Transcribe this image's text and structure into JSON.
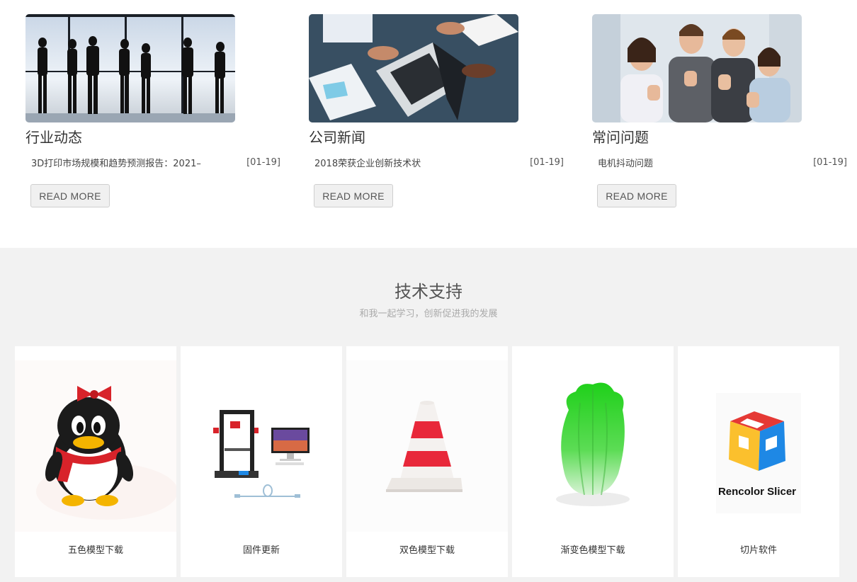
{
  "news": {
    "columns": [
      {
        "title": "行业动态",
        "item": "3D打印市场规模和趋势预测报告：2021–",
        "date": "[01-19]",
        "read_more": "READ MORE",
        "image": "business-silhouettes-photo"
      },
      {
        "title": "公司新闻",
        "item": "2018荣获企业创新技术状",
        "date": "[01-19]",
        "read_more": "READ MORE",
        "image": "laptop-meeting-photo"
      },
      {
        "title": "常问问题",
        "item": "电机抖动问题",
        "date": "[01-19]",
        "read_more": "READ MORE",
        "image": "team-thumbs-up-photo"
      }
    ]
  },
  "support": {
    "title": "技术支持",
    "subtitle": "和我一起学习，创新促进我的发展",
    "cards": [
      {
        "label": "五色模型下载",
        "image": "penguin-model"
      },
      {
        "label": "固件更新",
        "image": "printer-and-monitor"
      },
      {
        "label": "双色模型下载",
        "image": "traffic-cone-model"
      },
      {
        "label": "渐变色模型下载",
        "image": "cabbage-model"
      },
      {
        "label": "切片软件",
        "image": "rencolor-slicer-logo",
        "logo_text": "Rencolor Slicer"
      }
    ]
  },
  "colors": {
    "section_bg": "#f2f2f2",
    "button_bg": "#f0f0f0",
    "cone_red": "#e8283a",
    "cabbage_green": "#3fcf3a",
    "logo_red": "#e53935",
    "logo_blue": "#1e88e5",
    "logo_yellow": "#fbc02d"
  }
}
